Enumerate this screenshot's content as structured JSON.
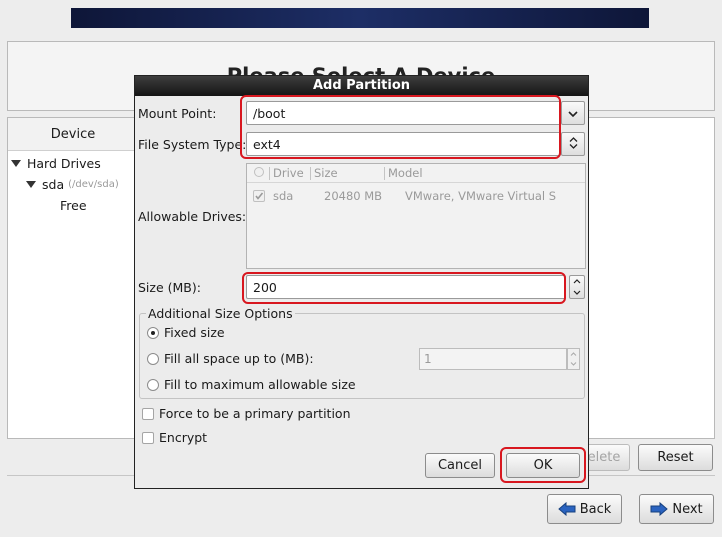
{
  "screen": {
    "title": "Please Select A Device",
    "device_column_header": "Device",
    "tree": {
      "root_label": "Hard Drives",
      "disk_label": "sda",
      "disk_path": "(/dev/sda)",
      "free_label": "Free"
    },
    "buttons": {
      "delete": "Delete",
      "reset": "Reset",
      "back": "Back",
      "next": "Next"
    }
  },
  "dialog": {
    "title": "Add Partition",
    "mount_point_label": "Mount Point:",
    "mount_point_value": "/boot",
    "fs_type_label": "File System Type:",
    "fs_type_value": "ext4",
    "allowable_drives_label": "Allowable Drives:",
    "drives": {
      "headers": [
        "Drive",
        "Size",
        "Model"
      ],
      "rows": [
        {
          "checked": true,
          "drive": "sda",
          "size": "20480 MB",
          "model": "VMware, VMware Virtual S"
        }
      ]
    },
    "size_label": "Size (MB):",
    "size_value": "200",
    "size_options": {
      "legend": "Additional Size Options",
      "fixed": "Fixed size",
      "fill_up_to": "Fill all space up to (MB):",
      "fill_up_to_value": "1",
      "fill_max": "Fill to maximum allowable size",
      "selected": "fixed"
    },
    "force_primary_label": "Force to be a primary partition",
    "encrypt_label": "Encrypt",
    "cancel_label": "Cancel",
    "ok_label": "OK"
  },
  "colors": {
    "highlight": "#d8171f",
    "banner": "#1d2e66",
    "dialog_title_bar": "#141414"
  },
  "icons": [
    "triangle-down-icon",
    "chevron-down-icon",
    "updown-arrows-icon",
    "back-arrow-icon",
    "next-arrow-icon",
    "checkbox-icon",
    "radio-icon"
  ]
}
